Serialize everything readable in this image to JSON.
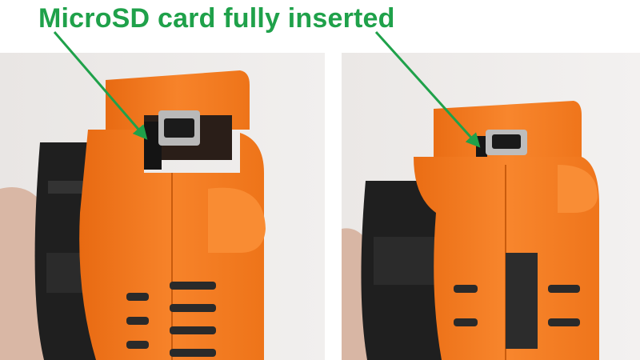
{
  "caption": "MicroSD card fully inserted",
  "colors": {
    "caption_green": "#1fa14a",
    "orange_plastic": "#f57d1f",
    "fan_black": "#222222",
    "background": "#ffffff"
  },
  "photos": [
    {
      "subject": "orange-printed-part-with-microsd-slot",
      "view": "angled"
    },
    {
      "subject": "orange-printed-part-with-microsd-slot",
      "view": "angled"
    }
  ]
}
